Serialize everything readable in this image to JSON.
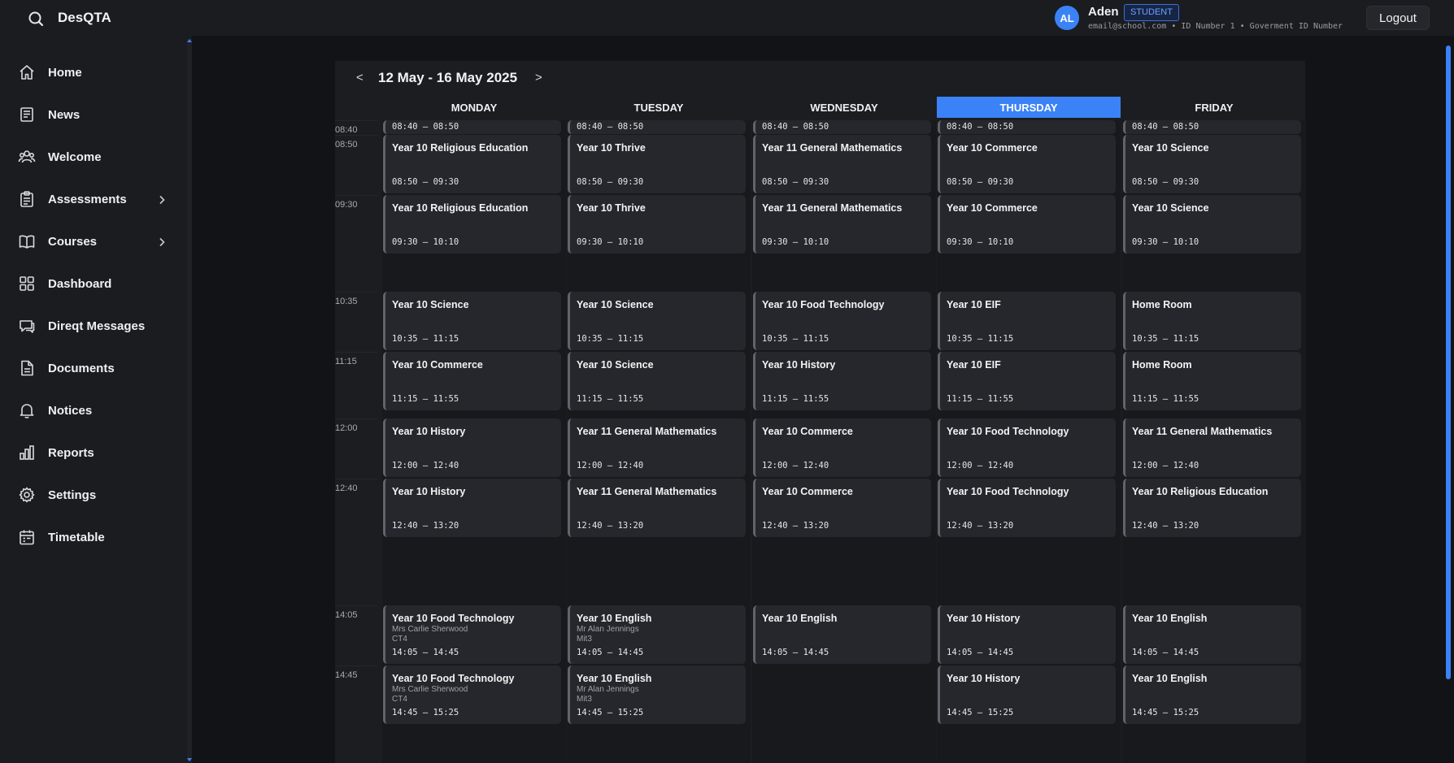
{
  "app": {
    "title": "DesQTA"
  },
  "user": {
    "initials": "AL",
    "name": "Aden",
    "role": "STUDENT",
    "meta": "email@school.com • ID Number 1 • Goverment ID Number",
    "logout_label": "Logout"
  },
  "sidebar": {
    "items": [
      {
        "label": "Home",
        "icon": "home-icon"
      },
      {
        "label": "News",
        "icon": "news-icon"
      },
      {
        "label": "Welcome",
        "icon": "people-icon"
      },
      {
        "label": "Assessments",
        "icon": "clipboard-icon",
        "has_chevron": true
      },
      {
        "label": "Courses",
        "icon": "book-icon",
        "has_chevron": true
      },
      {
        "label": "Dashboard",
        "icon": "grid-icon"
      },
      {
        "label": "Direqt Messages",
        "icon": "chat-icon"
      },
      {
        "label": "Documents",
        "icon": "document-icon"
      },
      {
        "label": "Notices",
        "icon": "bell-icon"
      },
      {
        "label": "Reports",
        "icon": "bar-chart-icon"
      },
      {
        "label": "Settings",
        "icon": "gear-icon"
      },
      {
        "label": "Timetable",
        "icon": "calendar-icon"
      }
    ]
  },
  "timetable": {
    "week_label": "12 May - 16 May 2025",
    "prev_label": "<",
    "next_label": ">",
    "accent_color": "#3b82f6",
    "times": [
      "08:40",
      "08:50",
      "09:30",
      "10:35",
      "11:15",
      "12:00",
      "12:40",
      "14:05",
      "14:45"
    ],
    "days": [
      {
        "name": "MONDAY",
        "active": false,
        "lessons": [
          {
            "title": "",
            "time": "08:40 – 08:50"
          },
          {
            "title": "Year 10 Religious Education",
            "time": "08:50 – 09:30"
          },
          {
            "title": "Year 10 Religious Education",
            "time": "09:30 – 10:10"
          },
          {
            "title": "Year 10 Science",
            "time": "10:35 – 11:15"
          },
          {
            "title": "Year 10 Commerce",
            "time": "11:15 – 11:55"
          },
          {
            "title": "Year 10 History",
            "time": "12:00 – 12:40"
          },
          {
            "title": "Year 10 History",
            "time": "12:40 – 13:20"
          },
          {
            "title": "Year 10 Food Technology",
            "teacher": "Mrs Carlie Sherwood",
            "room": "CT4",
            "time": "14:05 – 14:45"
          },
          {
            "title": "Year 10 Food Technology",
            "teacher": "Mrs Carlie Sherwood",
            "room": "CT4",
            "time": "14:45 – 15:25"
          }
        ]
      },
      {
        "name": "TUESDAY",
        "active": false,
        "lessons": [
          {
            "title": "",
            "time": "08:40 – 08:50"
          },
          {
            "title": "Year 10 Thrive",
            "time": "08:50 – 09:30"
          },
          {
            "title": "Year 10 Thrive",
            "time": "09:30 – 10:10"
          },
          {
            "title": "Year 10 Science",
            "time": "10:35 – 11:15"
          },
          {
            "title": "Year 10 Science",
            "time": "11:15 – 11:55"
          },
          {
            "title": "Year 11 General Mathematics",
            "time": "12:00 – 12:40"
          },
          {
            "title": "Year 11 General Mathematics",
            "time": "12:40 – 13:20"
          },
          {
            "title": "Year 10 English",
            "teacher": "Mr Alan Jennings",
            "room": "Mit3",
            "time": "14:05 – 14:45"
          },
          {
            "title": "Year 10 English",
            "teacher": "Mr Alan Jennings",
            "room": "Mit3",
            "time": "14:45 – 15:25"
          }
        ]
      },
      {
        "name": "WEDNESDAY",
        "active": false,
        "lessons": [
          {
            "title": "",
            "time": "08:40 – 08:50"
          },
          {
            "title": "Year 11 General Mathematics",
            "time": "08:50 – 09:30"
          },
          {
            "title": "Year 11 General Mathematics",
            "time": "09:30 – 10:10"
          },
          {
            "title": "Year 10 Food Technology",
            "time": "10:35 – 11:15"
          },
          {
            "title": "Year 10 History",
            "time": "11:15 – 11:55"
          },
          {
            "title": "Year 10 Commerce",
            "time": "12:00 – 12:40"
          },
          {
            "title": "Year 10 Commerce",
            "time": "12:40 – 13:20"
          },
          {
            "title": "Year 10 English",
            "time": "14:05 – 14:45"
          }
        ]
      },
      {
        "name": "THURSDAY",
        "active": true,
        "lessons": [
          {
            "title": "",
            "time": "08:40 – 08:50"
          },
          {
            "title": "Year 10 Commerce",
            "time": "08:50 – 09:30"
          },
          {
            "title": "Year 10 Commerce",
            "time": "09:30 – 10:10"
          },
          {
            "title": "Year 10 EIF",
            "time": "10:35 – 11:15"
          },
          {
            "title": "Year 10 EIF",
            "time": "11:15 – 11:55"
          },
          {
            "title": "Year 10 Food Technology",
            "time": "12:00 – 12:40"
          },
          {
            "title": "Year 10 Food Technology",
            "time": "12:40 – 13:20"
          },
          {
            "title": "Year 10 History",
            "time": "14:05 – 14:45"
          },
          {
            "title": "Year 10 History",
            "time": "14:45 – 15:25"
          }
        ]
      },
      {
        "name": "FRIDAY",
        "active": false,
        "lessons": [
          {
            "title": "",
            "time": "08:40 – 08:50"
          },
          {
            "title": "Year 10 Science",
            "time": "08:50 – 09:30"
          },
          {
            "title": "Year 10 Science",
            "time": "09:30 – 10:10"
          },
          {
            "title": "Home Room",
            "time": "10:35 – 11:15"
          },
          {
            "title": "Home Room",
            "time": "11:15 – 11:55"
          },
          {
            "title": "Year 11 General Mathematics",
            "time": "12:00 – 12:40"
          },
          {
            "title": "Year 10 Religious Education",
            "time": "12:40 – 13:20"
          },
          {
            "title": "Year 10 English",
            "time": "14:05 – 14:45"
          },
          {
            "title": "Year 10 English",
            "time": "14:45 – 15:25"
          }
        ]
      }
    ]
  }
}
